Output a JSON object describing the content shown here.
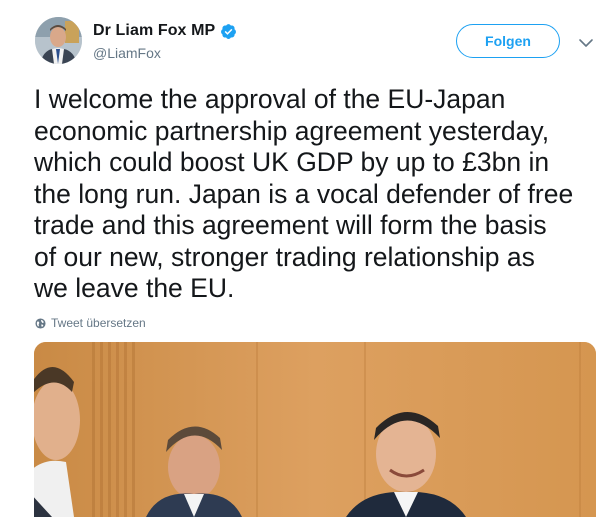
{
  "author": {
    "name": "Dr Liam Fox MP",
    "handle": "@LiamFox",
    "verified_icon": "verified-badge-icon"
  },
  "actions": {
    "follow_label": "Folgen",
    "menu_icon": "chevron-down-icon"
  },
  "tweet": {
    "text": "I welcome the approval of the EU-Japan\neconomic partnership agreement yesterday,\nwhich could boost UK GDP by up to £3bn in\nthe long run. Japan is a vocal defender of free\ntrade and this agreement will form the basis\nof our new, stronger trading relationship as\nwe leave the EU.",
    "translate_label": "Tweet übersetzen",
    "translate_icon": "globe-icon"
  },
  "media": {
    "type": "photo"
  },
  "colors": {
    "accent": "#1da1f2",
    "text": "#14171a",
    "muted": "#657786"
  }
}
